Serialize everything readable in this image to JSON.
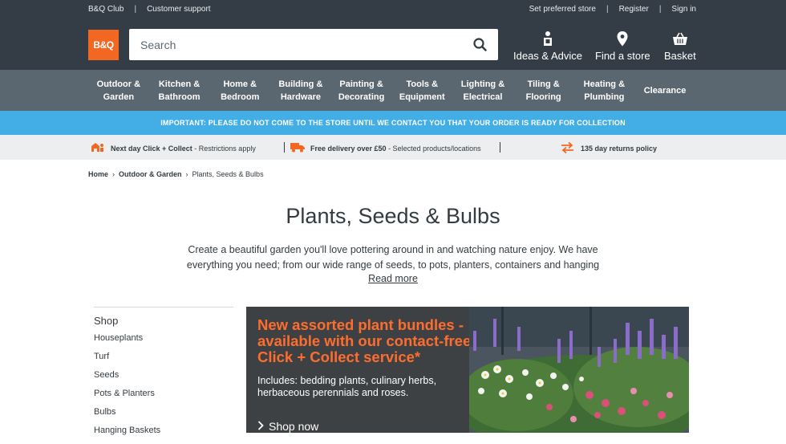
{
  "topbar": {
    "left": [
      "B&Q Club",
      "Customer support"
    ],
    "right": [
      "Set preferred store",
      "Register",
      "Sign in"
    ]
  },
  "header": {
    "logo_text": "B&Q",
    "search_placeholder": "Search",
    "links": [
      {
        "label": "Ideas & Advice",
        "icon": "person-ideas-icon"
      },
      {
        "label": "Find a store",
        "icon": "map-pin-icon"
      },
      {
        "label": "Basket",
        "icon": "basket-icon"
      }
    ]
  },
  "nav": {
    "categories": [
      "Outdoor &\nGarden",
      "Kitchen &\nBathroom",
      "Home &\nBedroom",
      "Building &\nHardware",
      "Painting &\nDecorating",
      "Tools &\nEquipment",
      "Lighting &\nElectrical",
      "Tiling &\nFlooring",
      "Heating &\nPlumbing",
      "Clearance"
    ]
  },
  "banner": {
    "important": "IMPORTANT: PLEASE DO NOT COME TO THE STORE UNTIL WE CONTACT YOU THAT YOUR ORDER IS READY FOR COLLECTION"
  },
  "usp": {
    "click_collect_bold": "Next day Click + Collect",
    "click_collect_rest": " - Restrictions apply",
    "delivery_bold": "Free delivery over £50",
    "delivery_rest": " - Selected products/locations",
    "returns": "135 day returns policy"
  },
  "breadcrumb": {
    "home": "Home",
    "parent": "Outdoor & Garden",
    "current": "Plants, Seeds & Bulbs"
  },
  "page": {
    "title": "Plants, Seeds & Bulbs",
    "intro": "Create a beautiful garden you'll love pottering around in and watching nature enjoy. We have everything you need; from our wide range of seeds, to pots, planters, containers and hanging",
    "read_more": "Read more"
  },
  "sidebar": {
    "title": "Shop",
    "items": [
      "Houseplants",
      "Turf",
      "Seeds",
      "Pots & Planters",
      "Bulbs",
      "Hanging Baskets"
    ]
  },
  "promo": {
    "headline": "New assorted plant bundles - available with our contact-free Click + Collect service*",
    "includes": "Includes: bedding plants, culinary herbs, herbaceous perennials and roses.",
    "cta": "Shop now"
  },
  "colors": {
    "header_bg": "#343d46",
    "nav_bg": "#5b6770",
    "brand_orange": "#f26722",
    "banner_blue": "#43aee5",
    "promo_orange": "#ff6d2e"
  }
}
